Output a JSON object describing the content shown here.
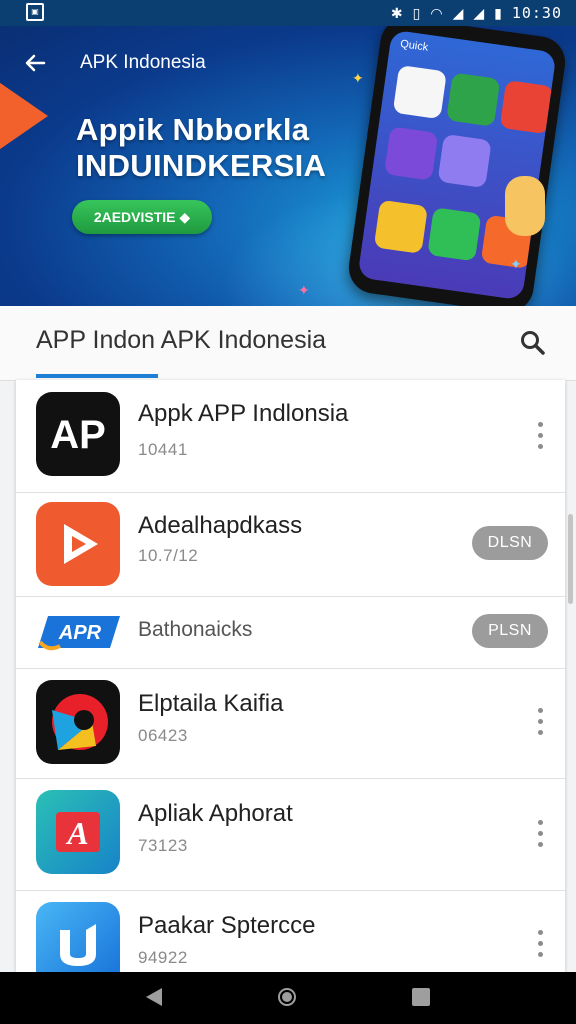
{
  "status_bar": {
    "time": "10:30"
  },
  "banner": {
    "header_label": "APK Indonesia",
    "title_line1": "Appik Nbborkla",
    "title_line2": "INDUINDKERSIA",
    "cta_label": "2AEDVISTIE ◆",
    "phone_header": "Quick"
  },
  "tabbar": {
    "title": "APP Indon APK Indonesia"
  },
  "apps": [
    {
      "name": "Appk APP Indlonsia",
      "sub": "10441",
      "action": "more"
    },
    {
      "name": "Adealhapdkass",
      "sub": "10.7/12",
      "action": "DLSN"
    },
    {
      "name": "Bathonaicks",
      "sub": "",
      "action": "PLSN",
      "logo_text": "APR"
    },
    {
      "name": "Elptaila Kaifia",
      "sub": "06423",
      "action": "more"
    },
    {
      "name": "Apliak Aphorat",
      "sub": "73123",
      "action": "more"
    },
    {
      "name": "Paakar Sptercce",
      "sub": "94922",
      "action": "more"
    }
  ],
  "colors": {
    "accent": "#1e7fd6",
    "banner_dark": "#0a2f74",
    "cta": "#2aae4b"
  }
}
